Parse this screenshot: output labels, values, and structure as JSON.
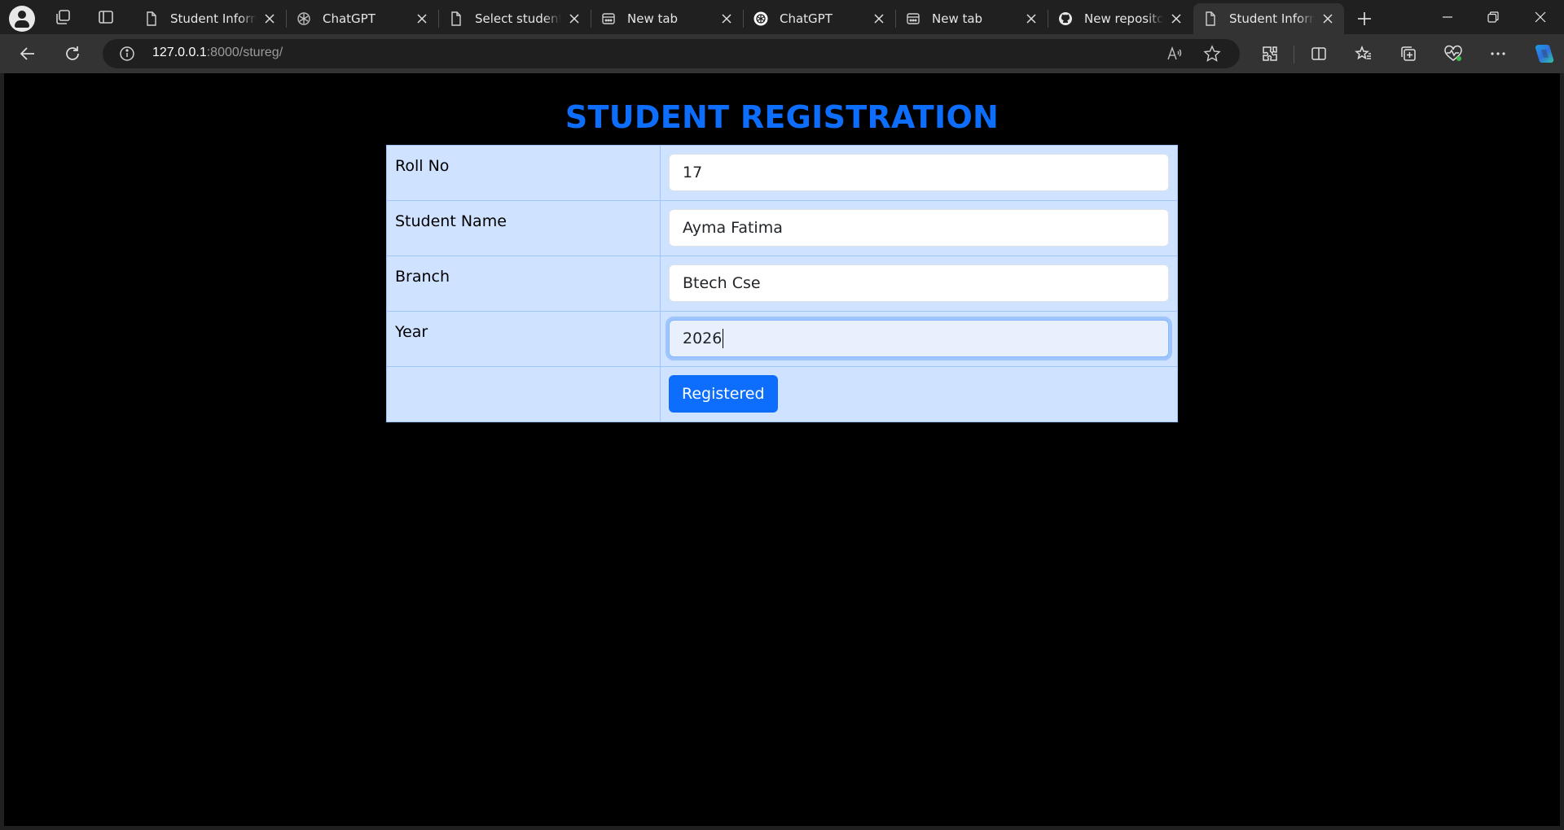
{
  "browser": {
    "tabs": [
      {
        "title": "Student Informat",
        "icon": "page-icon"
      },
      {
        "title": "ChatGPT",
        "icon": "chatgpt-icon"
      },
      {
        "title": "Select student to",
        "icon": "page-icon"
      },
      {
        "title": "New tab",
        "icon": "newtab-icon"
      },
      {
        "title": "ChatGPT",
        "icon": "chatgpt-icon"
      },
      {
        "title": "New tab",
        "icon": "newtab-icon"
      },
      {
        "title": "New repository",
        "icon": "github-icon"
      },
      {
        "title": "Student Informa",
        "icon": "page-icon"
      }
    ],
    "active_tab_index": 7,
    "url_host": "127.0.0.1",
    "url_rest": ":8000/stureg/"
  },
  "page": {
    "heading": "STUDENT REGISTRATION",
    "fields": [
      {
        "label": "Roll No",
        "value": "17"
      },
      {
        "label": "Student Name",
        "value": "Ayma Fatima"
      },
      {
        "label": "Branch",
        "value": "Btech Cse"
      },
      {
        "label": "Year",
        "value": "2026"
      }
    ],
    "submit_label": "Registered"
  },
  "colors": {
    "heading": "#0d6efd",
    "table_bg": "#cfe2ff",
    "button_bg": "#0d6efd",
    "page_bg": "#000000"
  }
}
